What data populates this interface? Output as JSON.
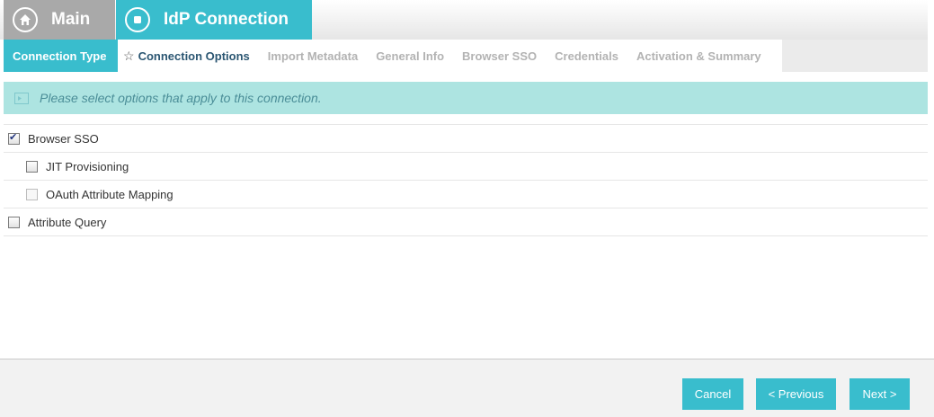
{
  "header": {
    "main_label": "Main",
    "main_icon": "home-icon",
    "connection_label": "IdP Connection",
    "connection_icon": "stop-icon"
  },
  "tabs": [
    {
      "label": "Connection Type",
      "state": "completed"
    },
    {
      "label": "Connection Options",
      "state": "active"
    },
    {
      "label": "Import Metadata",
      "state": "disabled"
    },
    {
      "label": "General Info",
      "state": "disabled"
    },
    {
      "label": "Browser SSO",
      "state": "disabled"
    },
    {
      "label": "Credentials",
      "state": "disabled"
    },
    {
      "label": "Activation & Summary",
      "state": "disabled"
    }
  ],
  "message": {
    "icon": "info-panel-icon",
    "text": "Please select options that apply to this connection."
  },
  "options": [
    {
      "label": "Browser SSO",
      "checked": true,
      "level": 1,
      "enabled": true
    },
    {
      "label": "JIT Provisioning",
      "checked": false,
      "level": 2,
      "enabled": true
    },
    {
      "label": "OAuth Attribute Mapping",
      "checked": false,
      "level": 2,
      "enabled": false
    },
    {
      "label": "Attribute Query",
      "checked": false,
      "level": 1,
      "enabled": true
    }
  ],
  "buttons": {
    "cancel": "Cancel",
    "previous": "< Previous",
    "next": "Next >"
  },
  "colors": {
    "accent": "#39bdcd",
    "message_bg": "#ade4e1",
    "main_tab_bg": "#a9a9a9",
    "active_tab_text": "#2b5672"
  }
}
